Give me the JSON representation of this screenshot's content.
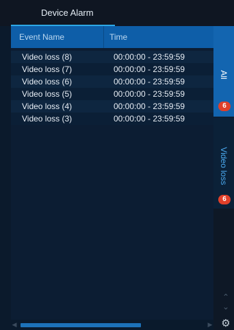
{
  "window": {
    "title": "Device Alarm"
  },
  "table": {
    "columns": {
      "name": "Event Name",
      "time": "Time"
    },
    "rows": [
      {
        "name": "Video loss (8)",
        "time": "00:00:00 - 23:59:59"
      },
      {
        "name": "Video loss (7)",
        "time": "00:00:00 - 23:59:59"
      },
      {
        "name": "Video loss (6)",
        "time": "00:00:00 - 23:59:59"
      },
      {
        "name": "Video loss (5)",
        "time": "00:00:00 - 23:59:59"
      },
      {
        "name": "Video loss (4)",
        "time": "00:00:00 - 23:59:59"
      },
      {
        "name": "Video loss (3)",
        "time": "00:00:00 - 23:59:59"
      }
    ]
  },
  "side_tabs": [
    {
      "label": "All",
      "count": "6",
      "selected": true
    },
    {
      "label": "Video loss",
      "count": "6",
      "selected": false
    }
  ],
  "scroll": {
    "horizontal_position_fraction": 0.0
  },
  "icons": {
    "scroll_left": "chevron-left-icon",
    "scroll_right": "chevron-right-icon",
    "up": "chevron-up-icon",
    "down": "chevron-down-icon",
    "settings": "gear-icon"
  },
  "colors": {
    "accent": "#1365b0",
    "header": "#0e5ea8",
    "badge": "#e0402a",
    "background": "#0b1a2c"
  }
}
